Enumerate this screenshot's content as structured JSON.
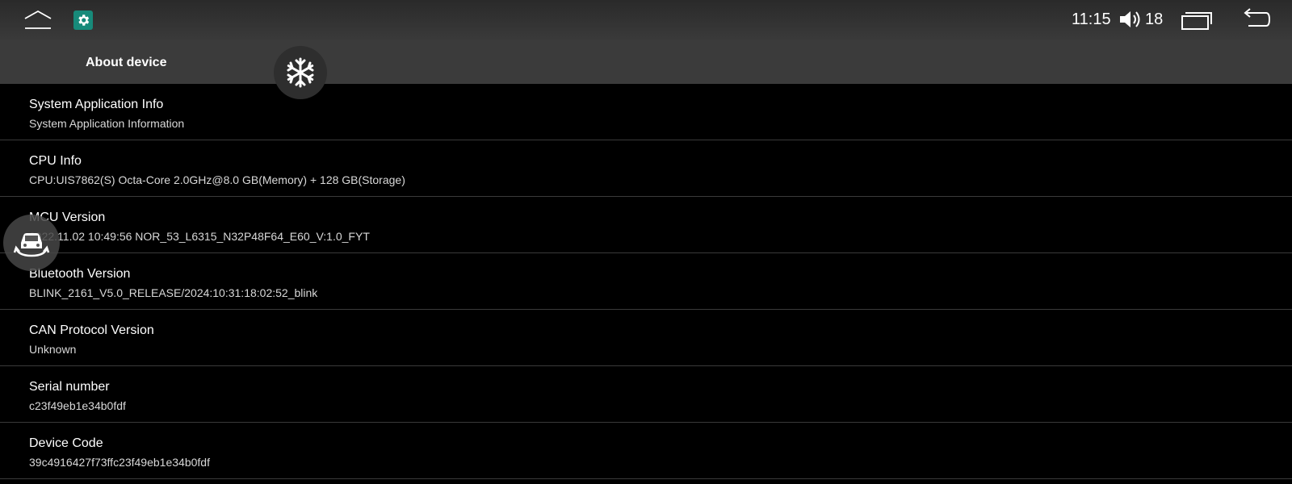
{
  "status_bar": {
    "time": "11:15",
    "volume": "18",
    "icons": {
      "home": "home-icon",
      "settings_app": "gear-icon",
      "volume": "speaker-icon",
      "recents": "recent-apps-icon",
      "back": "back-arrow-icon"
    }
  },
  "header": {
    "title": "About device"
  },
  "floating_buttons": {
    "ac": "snowflake-icon",
    "car": "car-rotate-icon"
  },
  "colors": {
    "settings_icon_bg": "#178a7a",
    "background": "#000000",
    "title_bar_bg": "#3b3b3b"
  },
  "items": [
    {
      "title": "System Application Info",
      "subtitle": "System Application Information"
    },
    {
      "title": "CPU Info",
      "subtitle": "CPU:UIS7862(S) Octa-Core 2.0GHz@8.0 GB(Memory) + 128 GB(Storage)"
    },
    {
      "title": "MCU Version",
      "subtitle": "2022.11.02 10:49:56 NOR_53_L6315_N32P48F64_E60_V:1.0_FYT"
    },
    {
      "title": "Bluetooth Version",
      "subtitle": "BLINK_2161_V5.0_RELEASE/2024:10:31:18:02:52_blink"
    },
    {
      "title": "CAN Protocol Version",
      "subtitle": "Unknown"
    },
    {
      "title": "Serial number",
      "subtitle": "c23f49eb1e34b0fdf"
    },
    {
      "title": "Device Code",
      "subtitle": "39c4916427f73ffc23f49eb1e34b0fdf"
    }
  ]
}
